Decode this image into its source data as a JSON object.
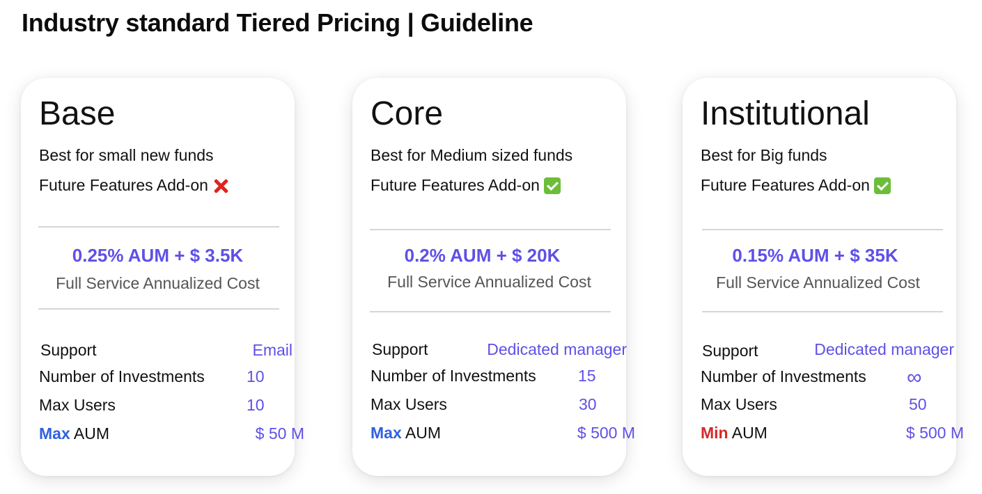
{
  "page": {
    "title": "Industry standard Tiered Pricing | Guideline"
  },
  "colors": {
    "accent": "#5f50e6",
    "max_highlight": "#2f62e0",
    "min_highlight": "#d42a2a"
  },
  "tiers": [
    {
      "name": "Base",
      "description": "Best for small new funds",
      "addon_label": "Future Features Add-on",
      "addon_icon": "cross-mark-icon",
      "price": "0.25% AUM + $ 3.5K",
      "price_caption": "Full Service Annualized Cost",
      "support_label": "Support",
      "support_value": "Email",
      "investments_label": "Number of Investments",
      "investments_value": "10",
      "users_label": "Max Users",
      "users_value": "10",
      "aum_prefix": "Max",
      "aum_label": "AUM",
      "aum_value": "$ 50 M"
    },
    {
      "name": "Core",
      "description": "Best for Medium sized funds",
      "addon_label": "Future Features Add-on",
      "addon_icon": "check-mark-icon",
      "price": "0.2% AUM + $ 20K",
      "price_caption": "Full Service Annualized Cost",
      "support_label": "Support",
      "support_value": "Dedicated manager",
      "investments_label": "Number of Investments",
      "investments_value": "15",
      "users_label": "Max Users",
      "users_value": "30",
      "aum_prefix": "Max",
      "aum_label": "AUM",
      "aum_value": "$ 500 M"
    },
    {
      "name": "Institutional",
      "description": "Best for Big funds",
      "addon_label": "Future Features Add-on",
      "addon_icon": "check-mark-icon",
      "price": "0.15% AUM + $ 35K",
      "price_caption": "Full Service Annualized Cost",
      "support_label": "Support",
      "support_value": "Dedicated manager",
      "investments_label": "Number of Investments",
      "investments_value": "∞",
      "users_label": "Max Users",
      "users_value": "50",
      "aum_prefix": "Min",
      "aum_label": "AUM",
      "aum_value": "$ 500 M"
    }
  ]
}
